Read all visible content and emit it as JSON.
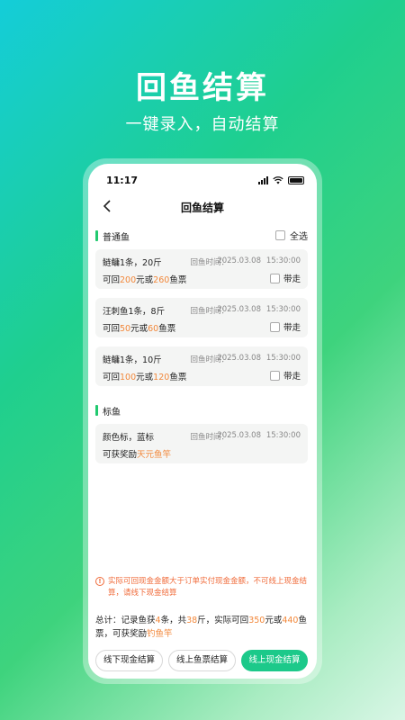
{
  "hero": {
    "title": "回鱼结算",
    "subtitle": "一键录入，自动结算"
  },
  "status": {
    "time": "11:17"
  },
  "nav": {
    "title": "回鱼结算"
  },
  "section_common": {
    "label": "普通鱼",
    "select_all": "全选"
  },
  "cards": [
    {
      "name": "鲢鳙1条，20斤",
      "time_label": "回鱼时间：",
      "date": "2025.03.08",
      "time": "15:30:00",
      "ret_prefix": "可回",
      "cash": "200",
      "cash_unit": "元或",
      "ticket": "260",
      "ticket_unit": "鱼票",
      "carry": "带走"
    },
    {
      "name": "汪刺鱼1条，8斤",
      "time_label": "回鱼时间：",
      "date": "2025.03.08",
      "time": "15:30:00",
      "ret_prefix": "可回",
      "cash": "50",
      "cash_unit": "元或",
      "ticket": "60",
      "ticket_unit": "鱼票",
      "carry": "带走"
    },
    {
      "name": "鲢鳙1条，10斤",
      "time_label": "回鱼时间：",
      "date": "2025.03.08",
      "time": "15:30:00",
      "ret_prefix": "可回",
      "cash": "100",
      "cash_unit": "元或",
      "ticket": "120",
      "ticket_unit": "鱼票",
      "carry": "带走"
    }
  ],
  "section_tagged": {
    "label": "标鱼"
  },
  "tag_card": {
    "name": "颜色标，蓝标",
    "time_label": "回鱼时间：",
    "date": "2025.03.08",
    "time": "15:30:00",
    "reward_prefix": "可获奖励",
    "reward": "天元鱼竿"
  },
  "warning": {
    "icon": "!",
    "text": "实际可回现金金额大于订单实付现金金额，不可线上现金结算，请线下现金结算"
  },
  "summary": {
    "p1": "总计：记录鱼获",
    "count": "4",
    "p2": "条，共",
    "weight": "38",
    "p3": "斤，实际可回",
    "cash": "350",
    "p4": "元或",
    "ticket": "440",
    "p5": "鱼票，可获奖励",
    "reward": "钓鱼竿"
  },
  "buttons": {
    "offline_cash": "线下现金结算",
    "online_ticket": "线上鱼票结算",
    "online_cash": "线上现金结算"
  },
  "colors": {
    "accent": "#1cc98a",
    "highlight": "#f2883b",
    "warning": "#f06b3a"
  }
}
